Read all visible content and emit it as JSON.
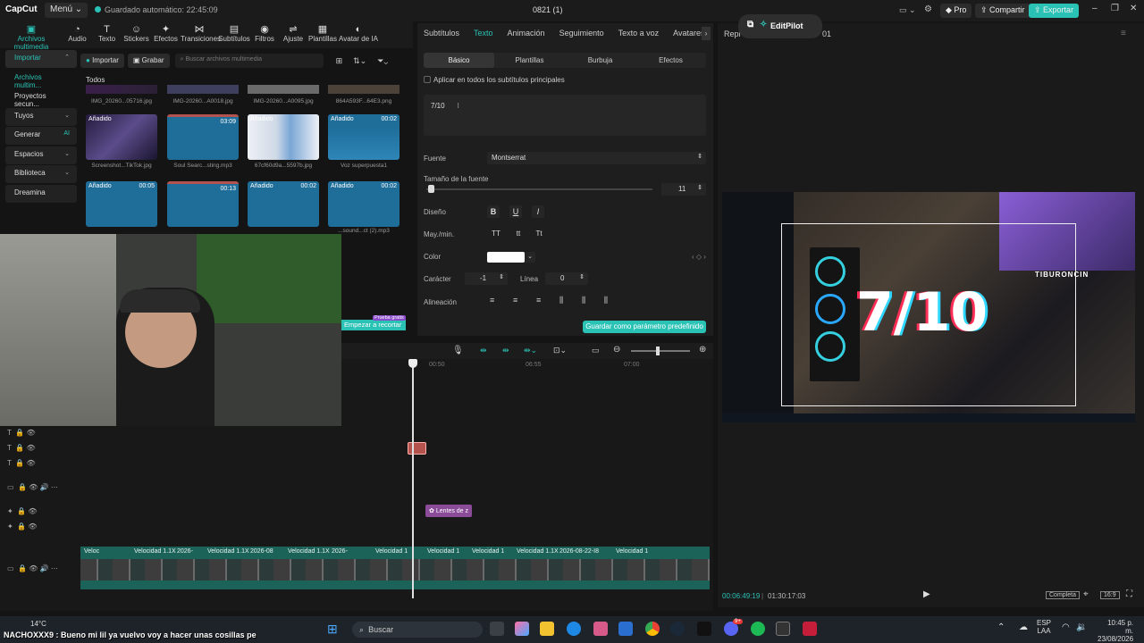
{
  "app": {
    "logo": "CapCut",
    "menu_label": "Menú",
    "autosave_text": "Guardado automático: 22:45:09",
    "project_title": "0821 (1)",
    "pro_label": "Pro",
    "share_label": "Compartir",
    "export_label": "Exportar"
  },
  "toolbar": {
    "items": [
      "Archivos multimedia",
      "Audio",
      "Texto",
      "Stickers",
      "Efectos",
      "Transiciones",
      "Subtítulos",
      "Filtros",
      "Ajuste",
      "Plantillas",
      "Avatar de IA"
    ]
  },
  "leftnav": {
    "items": [
      "Importar",
      "Archivos multim...",
      "Proyectos secun...",
      "Tuyos",
      "Generar",
      "Espacios",
      "Biblioteca",
      "Dreamina"
    ],
    "generar_badge": "AI"
  },
  "media": {
    "import_label": "Importar",
    "record_label": "Grabar",
    "search_placeholder": "Buscar archivos multimedia",
    "all_label": "Todos",
    "top_captions": [
      "IMG_20260...05716.jpg",
      "IMG-20260...A0018.jpg",
      "IMG-20260...A0095.jpg",
      "864A593F...64E3.png"
    ],
    "row1": [
      {
        "tag": "Añadido",
        "dur": "",
        "caption": "Screenshot...TikTok.jpg"
      },
      {
        "tag": "",
        "dur": "03:09",
        "caption": "Soul Searc...sting.mp3"
      },
      {
        "tag": "Añadido",
        "dur": "",
        "caption": "67cf60d9a...5597b.jpg"
      },
      {
        "tag": "Añadido",
        "dur": "00:02",
        "caption": "Voz superpuesta1"
      }
    ],
    "row2": [
      {
        "tag": "Añadido",
        "dur": "00:05"
      },
      {
        "tag": "",
        "dur": "00:13"
      },
      {
        "tag": "Añadido",
        "dur": "00:02"
      },
      {
        "tag": "Añadido",
        "dur": "00:02"
      }
    ],
    "row2_last_caption": "...sound...ct (2).mp3",
    "recortar_label": "Empezar a recortar",
    "recortar_badge": "Prueba gratis"
  },
  "panel": {
    "tabs": [
      "Subtítulos",
      "Texto",
      "Animación",
      "Seguimiento",
      "Texto a voz",
      "Avatares"
    ],
    "subtabs": [
      "Básico",
      "Plantillas",
      "Burbuja",
      "Efectos"
    ],
    "apply_all_label": "Aplicar en todos los subtítulos principales",
    "text_value": "7/10",
    "font_label": "Fuente",
    "font_value": "Montserrat",
    "size_label": "Tamaño de la fuente",
    "size_value": "11",
    "design_label": "Diseño",
    "case_label": "May./min.",
    "case_options": [
      "TT",
      "tt",
      "Tt"
    ],
    "color_label": "Color",
    "color_value": "#ffffff",
    "char_label": "Carácter",
    "char_value": "-1",
    "line_label": "Línea",
    "line_value": "0",
    "align_label": "Alineación",
    "save_preset_label": "Guardar como parámetro predefinido"
  },
  "player": {
    "editpilot_label": "EditPilot",
    "header_left": "Repr",
    "header_right": "01",
    "overlay_text": "7/10",
    "brand_text": "TIBURONCIN",
    "current_time": "00:06:49:19",
    "total_time": "01:30:17:03",
    "fit_label": "Completa",
    "ratio_label": "16:9"
  },
  "timeline": {
    "ruler": [
      "00:50",
      "06:55",
      "07:00"
    ],
    "clip_small_label": "Lentes de z",
    "strip_labels": [
      "Veloc",
      "Velocidad 1.1X",
      "2026-",
      "Velocidad 1.1X",
      "2026-08",
      "Velocidad 1.1X",
      "2026-",
      "Velocidad 1",
      "Velocidad 1",
      "Velocidad 1",
      "Velocidad 1.1X",
      "2026-08-22-I8",
      "Velocidad 1"
    ]
  },
  "taskbar": {
    "weather": "14°C",
    "search_label": "Buscar",
    "lang1": "ESP",
    "lang2": "LAA",
    "time": "10:45 p. m.",
    "date": "23/08/2026",
    "discord_badge": "9+"
  },
  "chat": {
    "user": "NACHOXXX9",
    "message": "Bueno mi lil ya vuelvo voy a hacer unas cosillas pe"
  }
}
